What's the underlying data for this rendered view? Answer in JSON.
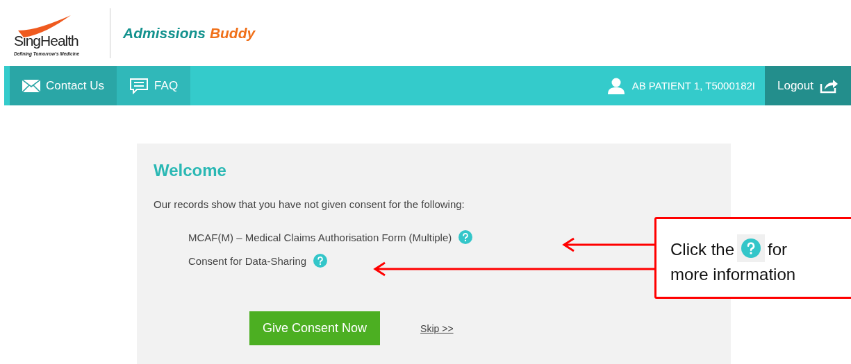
{
  "header": {
    "brand": "SingHealth",
    "tagline": "Defining Tomorrow's Medicine",
    "app_title": [
      "Admissions",
      "Buddy"
    ]
  },
  "nav": {
    "items": [
      {
        "kind": "mail",
        "label": "Contact Us"
      },
      {
        "kind": "chat",
        "label": "FAQ"
      }
    ],
    "user": "AB PATIENT 1, T5000182I",
    "logout": "Logout"
  },
  "card": {
    "title": "Welcome",
    "intro": "Our records show that you have not given consent for the following:",
    "consents": [
      "MCAF(M) – Medical Claims Authorisation Form (Multiple)",
      "Consent for Data-Sharing"
    ],
    "button": "Give Consent Now",
    "skip": "Skip >>"
  },
  "callout": {
    "before_icon": "Click the",
    "after_icon": "for",
    "second_line": "more information"
  }
}
